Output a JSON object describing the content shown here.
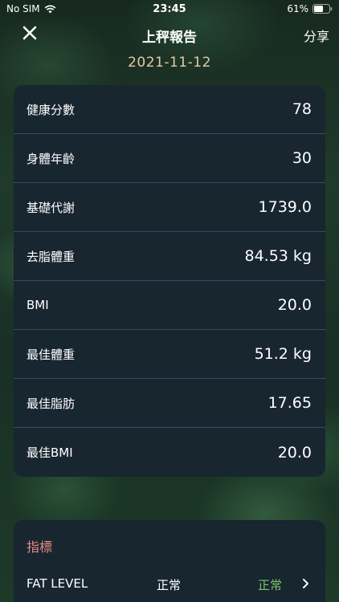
{
  "status_bar": {
    "carrier": "No SIM",
    "time": "23:45",
    "battery": "61%",
    "battery_level": 0.61
  },
  "nav": {
    "title": "上秤報告",
    "share_label": "分享",
    "close_icon": "close-icon"
  },
  "report_date": "2021-11-12",
  "metrics": [
    {
      "label": "健康分數",
      "value": "78"
    },
    {
      "label": "身體年齡",
      "value": "30"
    },
    {
      "label": "基礎代謝",
      "value": "1739.0"
    },
    {
      "label": "去脂體重",
      "value": "84.53 kg"
    },
    {
      "label": "BMI",
      "value": "20.0"
    },
    {
      "label": "最佳體重",
      "value": "51.2 kg"
    },
    {
      "label": "最佳脂肪",
      "value": "17.65"
    },
    {
      "label": "最佳BMI",
      "value": "20.0"
    }
  ],
  "indicators": {
    "title": "指標",
    "rows": [
      {
        "label": "FAT LEVEL",
        "description": "正常",
        "status": "正常",
        "icon": "chevron-right-icon"
      }
    ]
  },
  "colors": {
    "date": "#e3caa4",
    "indicator_title": "#e58a82",
    "status_ok": "#7fc06a",
    "card_bg": "#182630"
  }
}
